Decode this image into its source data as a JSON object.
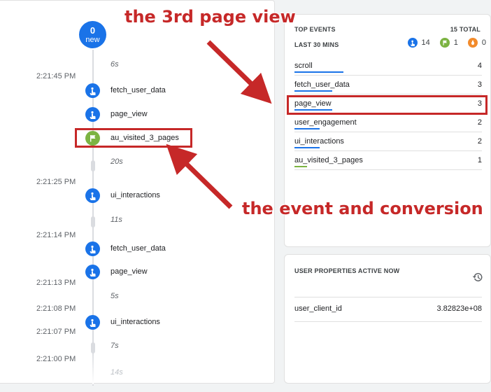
{
  "timeline": {
    "badge": {
      "count": "0",
      "label": "new"
    },
    "time_labels": [
      "2:21:45 PM",
      "2:21:25 PM",
      "2:21:14 PM",
      "2:21:13 PM",
      "2:21:08 PM",
      "2:21:07 PM",
      "2:21:00 PM"
    ],
    "gaps": [
      "6s",
      "20s",
      "11s",
      "5s",
      "7s",
      "14s"
    ],
    "events": [
      "fetch_user_data",
      "page_view",
      "au_visited_3_pages",
      "ui_interactions",
      "fetch_user_data",
      "page_view",
      "ui_interactions"
    ]
  },
  "top_events": {
    "title": "TOP EVENTS",
    "total": "15 TOTAL",
    "period": "LAST 30 MINS",
    "counts": {
      "events": "14",
      "conversions": "1",
      "errors": "0"
    },
    "rows": [
      {
        "name": "scroll",
        "value": "4",
        "share": 0.267
      },
      {
        "name": "fetch_user_data",
        "value": "3",
        "share": 0.2
      },
      {
        "name": "page_view",
        "value": "3",
        "share": 0.2
      },
      {
        "name": "user_engagement",
        "value": "2",
        "share": 0.133
      },
      {
        "name": "ui_interactions",
        "value": "2",
        "share": 0.133
      },
      {
        "name": "au_visited_3_pages",
        "value": "1",
        "share": 0.067
      }
    ]
  },
  "user_properties": {
    "title": "USER PROPERTIES ACTIVE NOW",
    "rows": [
      {
        "key": "user_client_id",
        "value": "3.82823e+08"
      }
    ]
  },
  "annotations": {
    "page_view_note": "the 3rd page view",
    "conversion_note": "the event and conversion"
  },
  "colors": {
    "accent": "#1a73e8",
    "conversion": "#7cb342",
    "error": "#f28b2c",
    "annotation": "#c62828"
  }
}
